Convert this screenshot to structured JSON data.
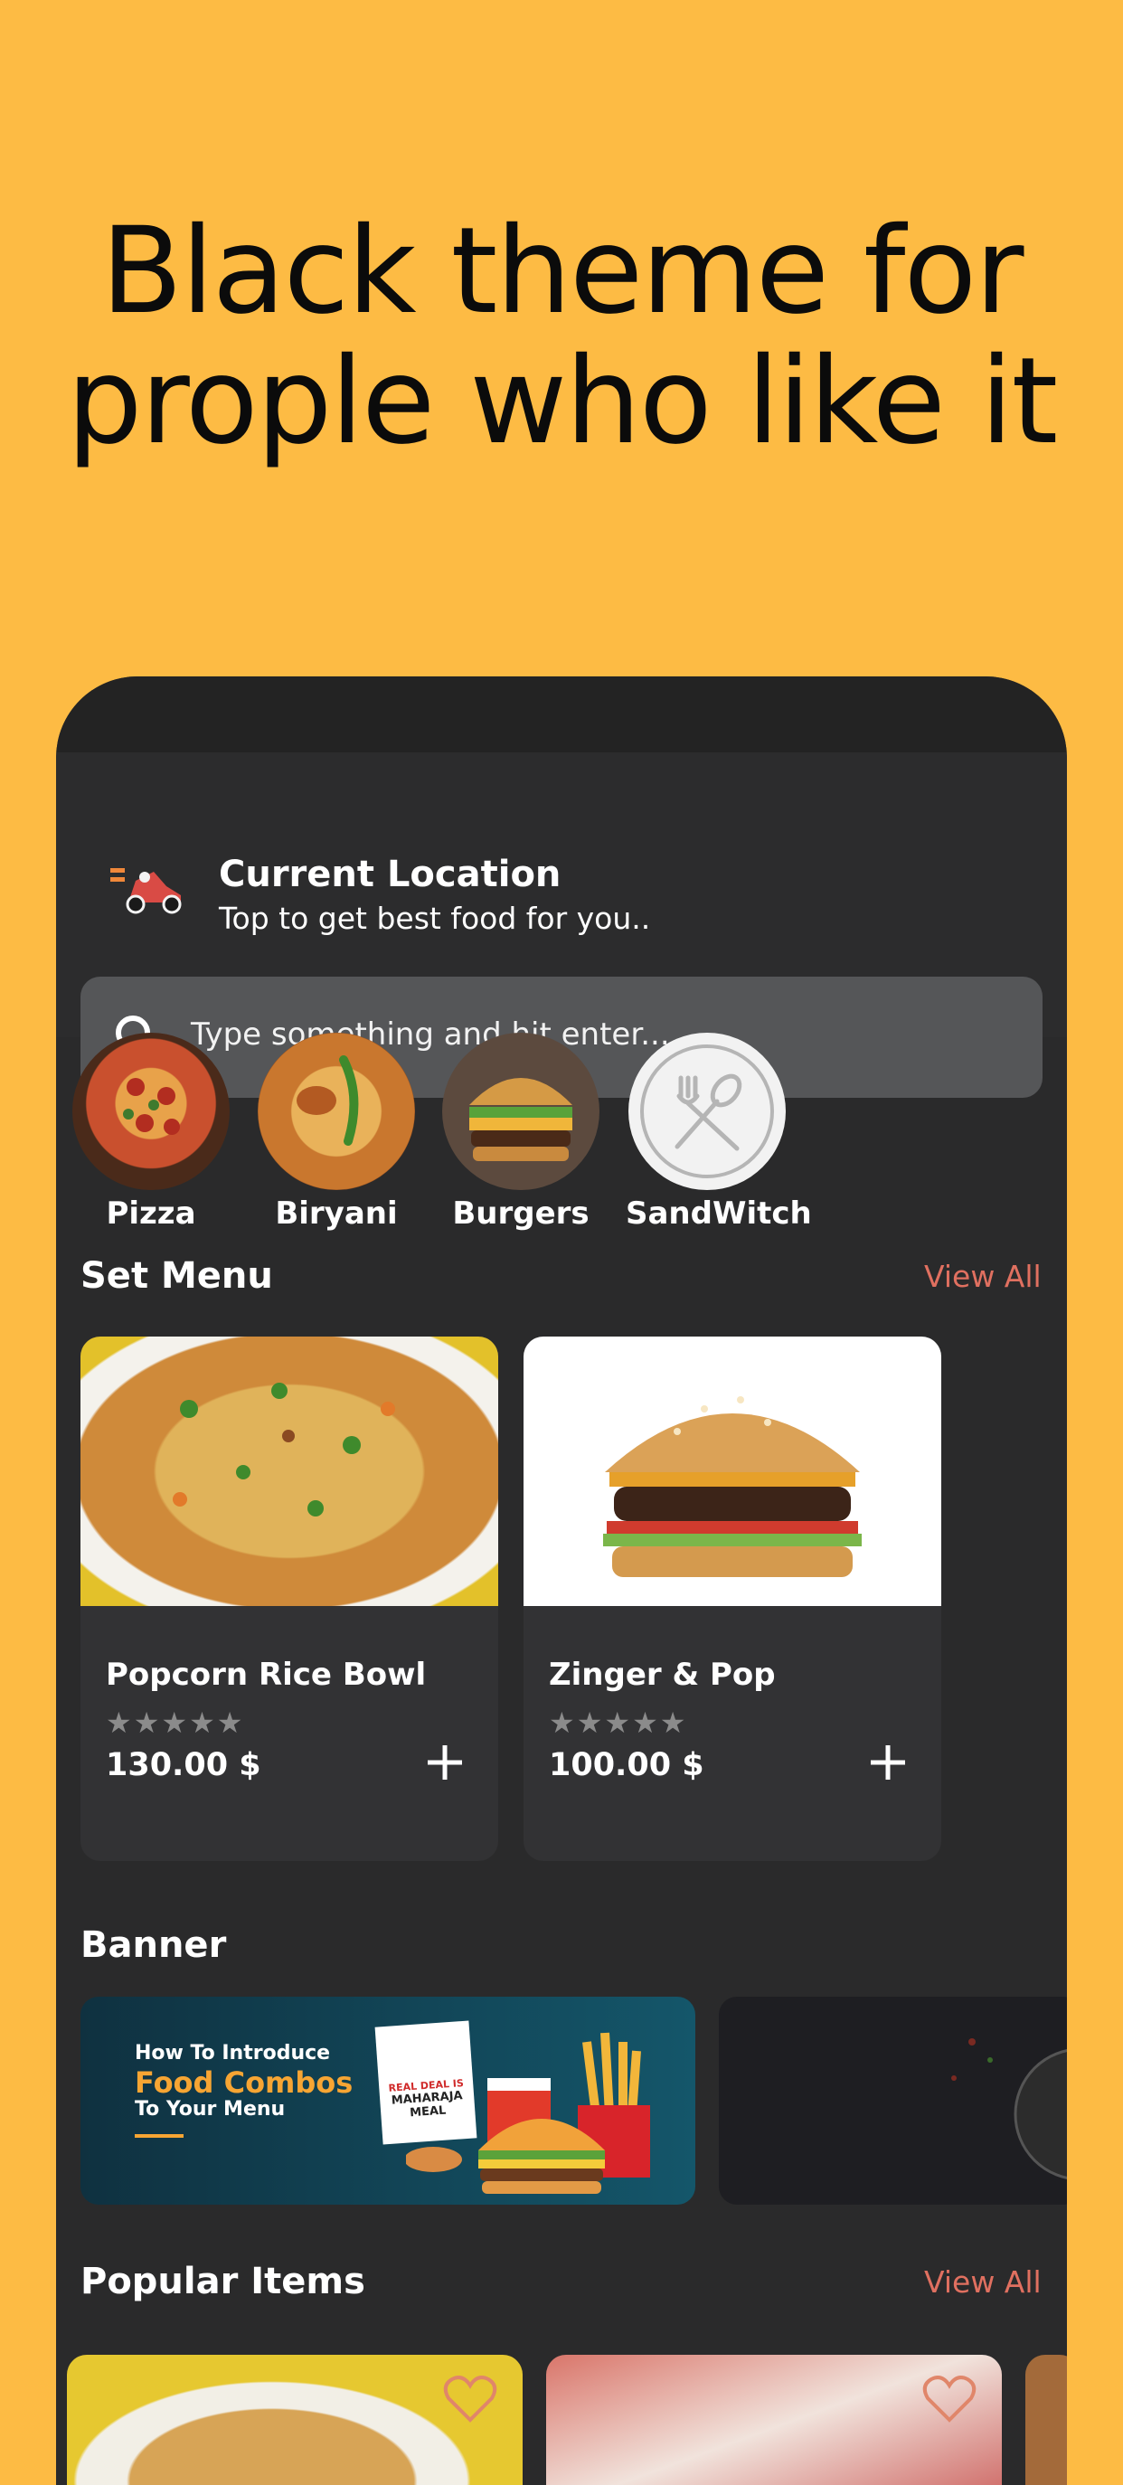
{
  "headline": {
    "line1": "Black theme for",
    "line2": "prople who like it"
  },
  "header": {
    "location_title": "Current Location",
    "location_subtitle": "Top to get best food for you.."
  },
  "search": {
    "placeholder": "Type something and hit enter..."
  },
  "categories": [
    {
      "label": "Pizza"
    },
    {
      "label": "Biryani"
    },
    {
      "label": "Burgers"
    },
    {
      "label": "SandWitch"
    }
  ],
  "set_menu": {
    "title": "Set Menu",
    "view_all": "View All",
    "items": [
      {
        "name": "Popcorn Rice Bowl",
        "stars": "★★★★★",
        "price": "130.00 $"
      },
      {
        "name": "Zinger & Pop",
        "stars": "★★★★★",
        "price": "100.00 $"
      }
    ]
  },
  "banner": {
    "title": "Banner",
    "promo_line1": "How To Introduce",
    "promo_line2": "Food Combos",
    "promo_line3": "To Your Menu",
    "sign_line1": "REAL DEAL IS",
    "sign_line2": "MAHARAJA",
    "sign_line3": "MEAL"
  },
  "popular": {
    "title": "Popular Items",
    "view_all": "View All"
  },
  "colors": {
    "background": "#FDBB44",
    "surface": "#2a2a2b",
    "accent": "#e07060",
    "search": "#555658"
  }
}
